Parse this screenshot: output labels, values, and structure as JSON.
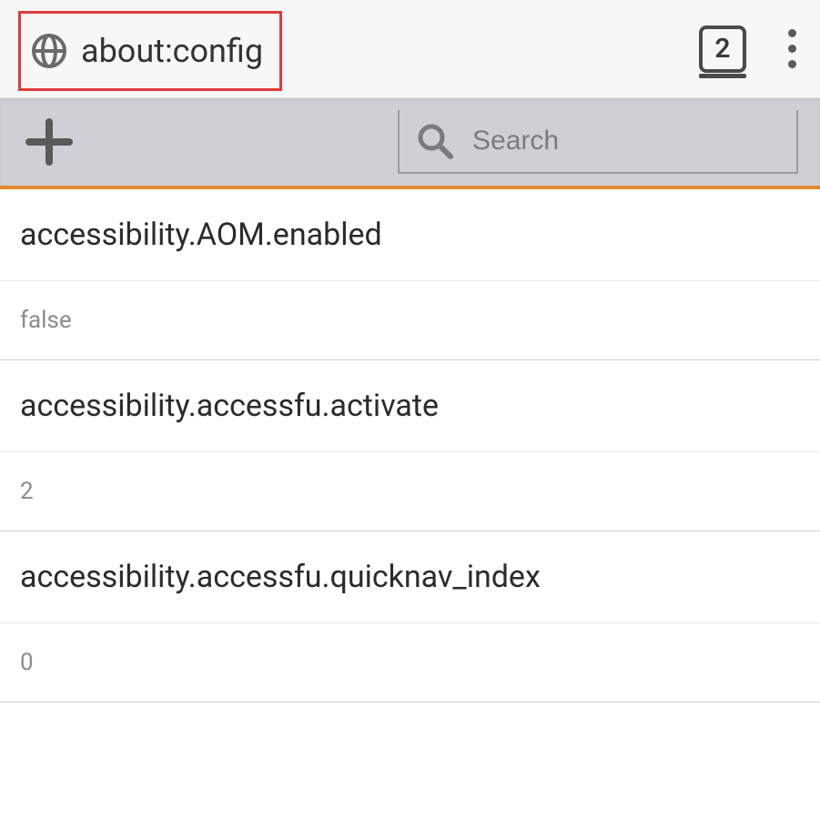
{
  "topbar": {
    "url": "about:config",
    "tab_count": "2"
  },
  "toolbar": {
    "search_placeholder": "Search"
  },
  "prefs": [
    {
      "name": "accessibility.AOM.enabled",
      "value": "false"
    },
    {
      "name": "accessibility.accessfu.activate",
      "value": "2"
    },
    {
      "name": "accessibility.accessfu.quicknav_index",
      "value": "0"
    }
  ]
}
